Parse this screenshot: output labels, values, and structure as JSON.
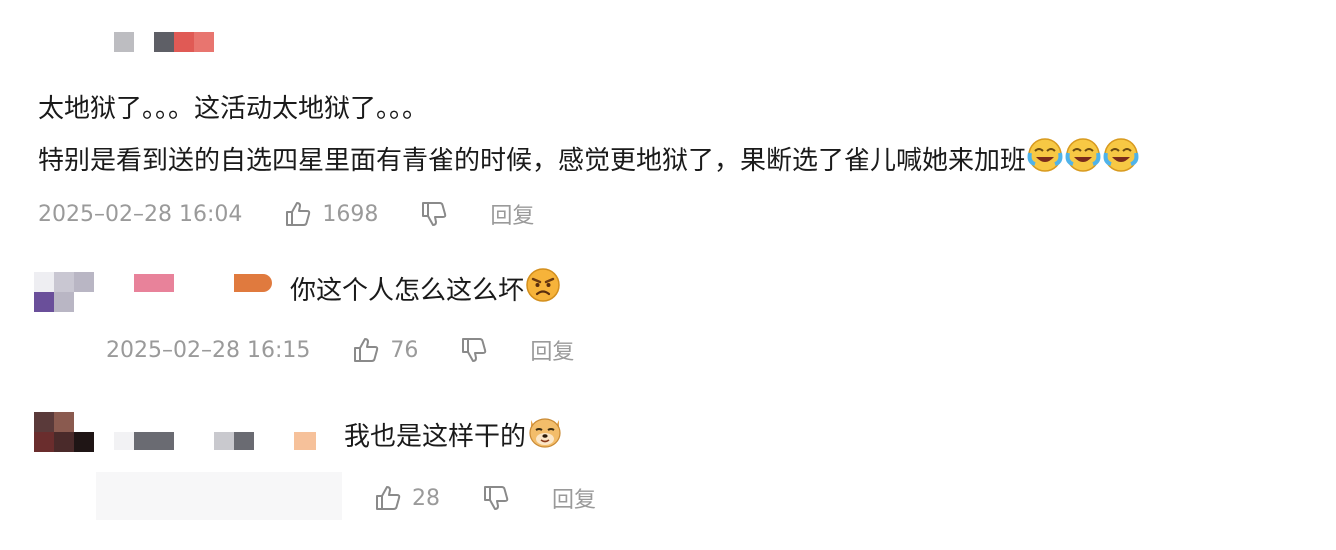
{
  "main_comment": {
    "line1": "太地狱了。。。这活动太地狱了。。。",
    "line2": "特别是看到送的自选四星里面有青雀的时候，感觉更地狱了，果断选了雀儿喊她来加班",
    "timestamp": "2025–02–28 16:04",
    "likes": "1698",
    "reply_label": "回复",
    "emoji_after_line2": [
      "crying-laughing-icon",
      "crying-laughing-icon",
      "crying-laughing-icon"
    ]
  },
  "reply_1": {
    "text": "你这个人怎么这么坏",
    "emoji": "angry-face-icon",
    "timestamp": "2025–02–28 16:15",
    "likes": "76",
    "reply_label": "回复"
  },
  "reply_2": {
    "text": "我也是这样干的",
    "emoji": "doge-icon",
    "likes": "28",
    "reply_label": "回复"
  },
  "colors": {
    "text": "#1a1a1a",
    "meta": "#9a9a9a"
  }
}
